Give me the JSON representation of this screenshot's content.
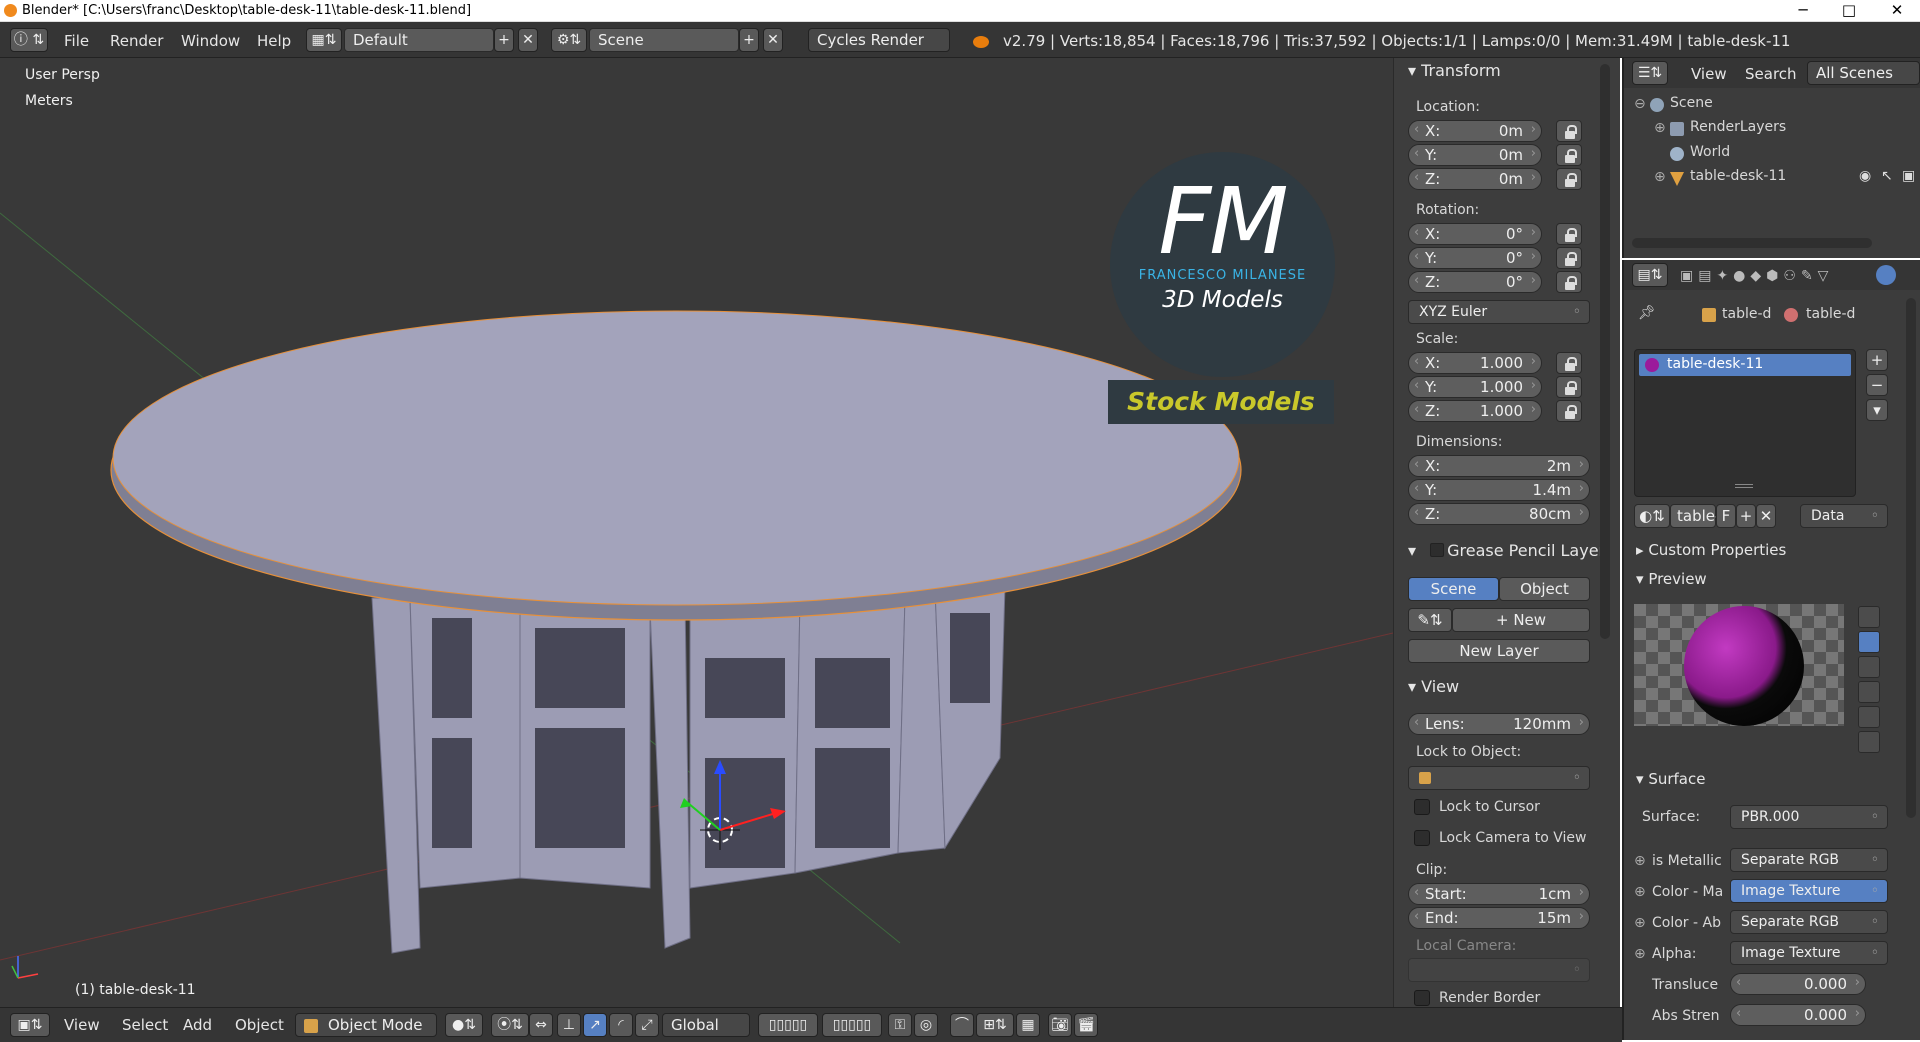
{
  "titlebar": {
    "title": "Blender* [C:\\Users\\franc\\Desktop\\table-desk-11\\table-desk-11.blend]",
    "minimize": "─",
    "maximize": "□",
    "close": "✕"
  },
  "infobar": {
    "menus": [
      "File",
      "Render",
      "Window",
      "Help"
    ],
    "screen_layout": "Default",
    "scene": "Scene",
    "engine": "Cycles Render",
    "stats": "v2.79 | Verts:18,854 | Faces:18,796 | Tris:37,592 | Objects:1/1 | Lamps:0/0 | Mem:31.49M | table-desk-11"
  },
  "viewport": {
    "view_name": "User Persp",
    "units": "Meters",
    "object_label": "(1) table-desk-11"
  },
  "watermark": {
    "logo": "FM",
    "subtitle": "FRANCESCO MILANESE",
    "line2": "3D Models",
    "banner": "Stock Models"
  },
  "npanel": {
    "transform": {
      "header": "Transform",
      "location_label": "Location:",
      "location": [
        {
          "k": "X:",
          "v": "0m"
        },
        {
          "k": "Y:",
          "v": "0m"
        },
        {
          "k": "Z:",
          "v": "0m"
        }
      ],
      "rotation_label": "Rotation:",
      "rotation": [
        {
          "k": "X:",
          "v": "0°"
        },
        {
          "k": "Y:",
          "v": "0°"
        },
        {
          "k": "Z:",
          "v": "0°"
        }
      ],
      "rotation_mode": "XYZ Euler",
      "scale_label": "Scale:",
      "scale": [
        {
          "k": "X:",
          "v": "1.000"
        },
        {
          "k": "Y:",
          "v": "1.000"
        },
        {
          "k": "Z:",
          "v": "1.000"
        }
      ],
      "dimensions_label": "Dimensions:",
      "dimensions": [
        {
          "k": "X:",
          "v": "2m"
        },
        {
          "k": "Y:",
          "v": "1.4m"
        },
        {
          "k": "Z:",
          "v": "80cm"
        }
      ]
    },
    "grease": {
      "header": "Grease Pencil Layer",
      "tab_scene": "Scene",
      "tab_object": "Object",
      "new": "New",
      "new_layer": "New Layer"
    },
    "view": {
      "header": "View",
      "lens_k": "Lens:",
      "lens_v": "120mm",
      "lock_to_object": "Lock to Object:",
      "lock_to_cursor": "Lock to Cursor",
      "lock_camera": "Lock Camera to View",
      "clip": "Clip:",
      "start_k": "Start:",
      "start_v": "1cm",
      "end_k": "End:",
      "end_v": "15m",
      "local_camera": "Local Camera:",
      "render_border": "Render Border"
    }
  },
  "outliner": {
    "tabs": [
      "View",
      "Search",
      "All Scenes"
    ],
    "items": [
      "Scene",
      "RenderLayers",
      "World",
      "table-desk-11"
    ]
  },
  "properties": {
    "breadcrumb": [
      "table-d",
      "table-d"
    ],
    "material_slot": "table-desk-11",
    "datablock_name": "table-",
    "datablock_users": "F",
    "link": "Data",
    "custom_properties": "Custom Properties",
    "preview": "Preview",
    "surface_header": "Surface",
    "rows": [
      {
        "label": "Surface:",
        "value": "PBR.000"
      },
      {
        "label": "is Metallic",
        "value": "Separate RGB"
      },
      {
        "label": "Color - Ma",
        "value": "Image Texture"
      },
      {
        "label": "Color - Ab",
        "value": "Separate RGB"
      },
      {
        "label": "Alpha:",
        "value": "Image Texture"
      }
    ],
    "translucency_label": "Transluce",
    "translucency_value": "0.000",
    "abs_label": "Abs Stren",
    "abs_value": "0.000"
  },
  "bottombar": {
    "menus": [
      "View",
      "Select",
      "Add",
      "Object"
    ],
    "mode": "Object Mode",
    "orientation": "Global"
  },
  "colors": {
    "viewport_bg": "#393939",
    "panel_bg": "#3d3d3d",
    "selected_blue": "#5680c2",
    "tab_active": "#5680c2",
    "table": "#a3a3bb"
  }
}
